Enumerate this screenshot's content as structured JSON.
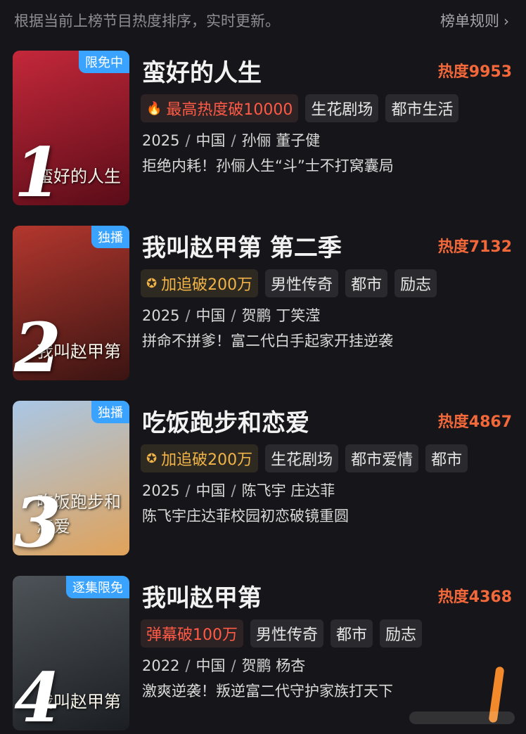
{
  "header": {
    "description": "根据当前上榜节目热度排序，实时更新。",
    "rules_label": "榜单规则",
    "rules_icon": "chevron-right-icon"
  },
  "items": [
    {
      "rank": "1",
      "badge": "限免中",
      "poster_title": "蛮好的人生",
      "title": "蛮好的人生",
      "heat": "热度9953",
      "tags": [
        {
          "label": "最高热度破10000",
          "style": "hot",
          "icon": "fire-icon"
        },
        {
          "label": "生花剧场",
          "style": "plain"
        },
        {
          "label": "都市生活",
          "style": "plain"
        }
      ],
      "year": "2025",
      "region": "中国",
      "cast": "孙俪 董子健",
      "blurb": "拒绝内耗！孙俪人生“斗”士不打窝囊局",
      "colors": [
        "#c4283a",
        "#5a0c18"
      ]
    },
    {
      "rank": "2",
      "badge": "独播",
      "poster_title": "我叫赵甲第",
      "title": "我叫赵甲第 第二季",
      "heat": "热度7132",
      "tags": [
        {
          "label": "加追破200万",
          "style": "gold",
          "icon": "star-badge-icon"
        },
        {
          "label": "男性传奇",
          "style": "plain"
        },
        {
          "label": "都市",
          "style": "plain"
        },
        {
          "label": "励志",
          "style": "plain"
        }
      ],
      "year": "2025",
      "region": "中国",
      "cast": "贺鹏 丁笑滢",
      "blurb": "拼命不拼爹！富二代白手起家开挂逆袭",
      "colors": [
        "#b3372e",
        "#3a1412"
      ]
    },
    {
      "rank": "3",
      "badge": "独播",
      "poster_title": "吃饭跑步和恋爱",
      "title": "吃饭跑步和恋爱",
      "heat": "热度4867",
      "tags": [
        {
          "label": "加追破200万",
          "style": "gold",
          "icon": "star-badge-icon"
        },
        {
          "label": "生花剧场",
          "style": "plain"
        },
        {
          "label": "都市爱情",
          "style": "plain"
        },
        {
          "label": "都市",
          "style": "plain"
        }
      ],
      "year": "2025",
      "region": "中国",
      "cast": "陈飞宇 庄达菲",
      "blurb": "陈飞宇庄达菲校园初恋破镜重圆",
      "colors": [
        "#a9c7e6",
        "#e0a25a"
      ]
    },
    {
      "rank": "4",
      "badge": "逐集限免",
      "poster_title": "我叫赵甲第",
      "title": "我叫赵甲第",
      "heat": "热度4368",
      "tags": [
        {
          "label": "弹幕破100万",
          "style": "hot"
        },
        {
          "label": "男性传奇",
          "style": "plain"
        },
        {
          "label": "都市",
          "style": "plain"
        },
        {
          "label": "励志",
          "style": "plain"
        }
      ],
      "year": "2022",
      "region": "中国",
      "cast": "贺鹏 杨杏",
      "blurb": "激爽逆袭！叛逆富二代守护家族打天下",
      "colors": [
        "#4d5358",
        "#1b1e22"
      ]
    }
  ],
  "colors": {
    "background": "#16161a",
    "heat": "#f2683a",
    "badge": "#3aa3ff",
    "tag_bg": "#2a2a2e"
  }
}
